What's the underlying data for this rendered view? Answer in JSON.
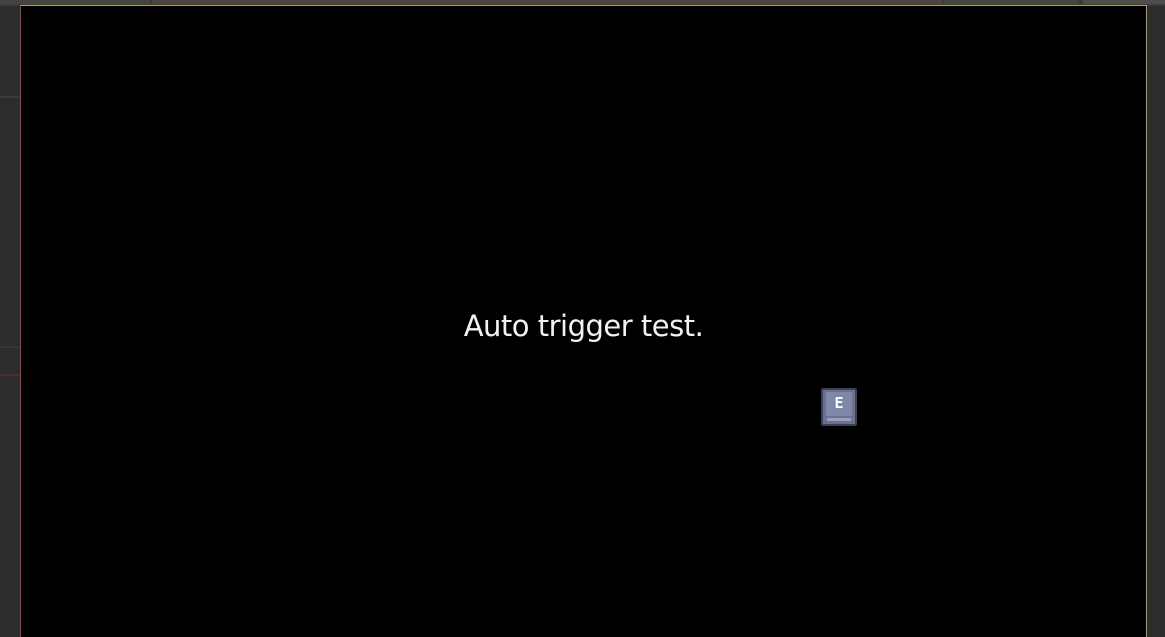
{
  "game": {
    "message": "Auto trigger test.",
    "prompt_key": "E"
  },
  "colors": {
    "viewport_background": "#000000",
    "message_text": "#f2f2f2",
    "key_fill": "#6c7190",
    "key_face": "#8088a8",
    "editor_background": "#2b2b2b"
  },
  "icons": {
    "key_prompt": "keyboard-key-icon"
  }
}
